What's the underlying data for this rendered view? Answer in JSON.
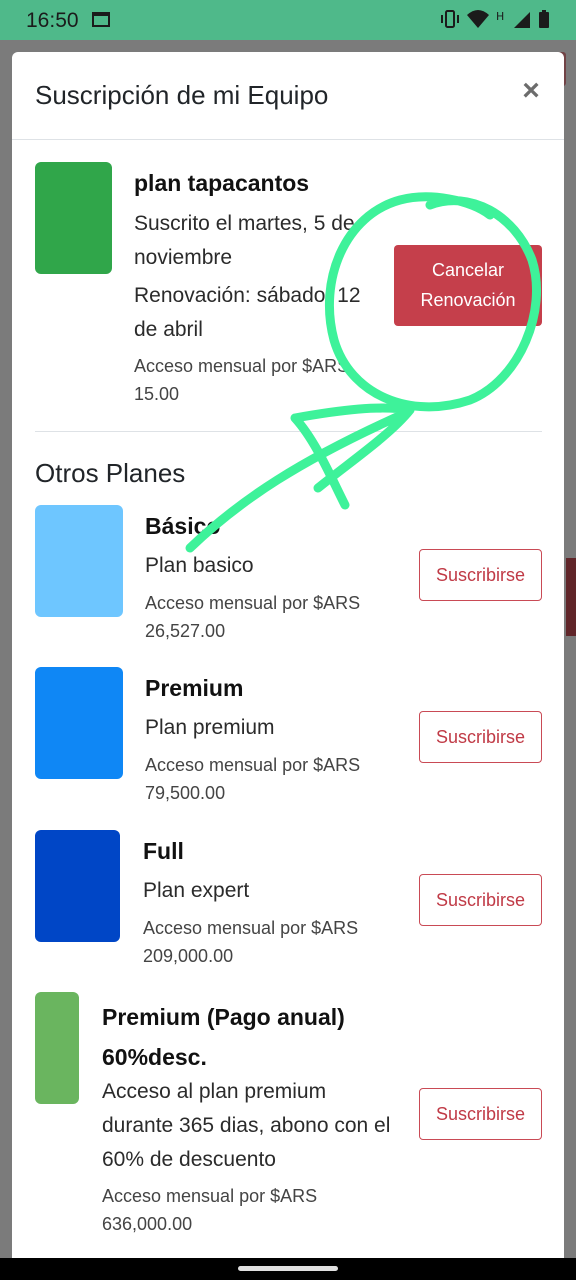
{
  "status_bar": {
    "time": "16:50",
    "icons": [
      "calendar-icon",
      "vibrate-icon",
      "wifi-icon",
      "h-network-icon",
      "signal-icon",
      "battery-icon"
    ]
  },
  "modal": {
    "title": "Suscripción de mi Equipo",
    "close_label": "×"
  },
  "current_plan": {
    "name": "plan tapacantos",
    "subscribed": "Suscrito el martes, 5 de noviembre",
    "renewal": "Renovación: sábado, 12 de abril",
    "price": "Acceso mensual por $ARS 15.00",
    "color": "#30a64a",
    "cancel_label": "Cancelar Renovación"
  },
  "other_plans": {
    "title": "Otros Planes",
    "subscribe_label": "Suscribirse",
    "items": [
      {
        "name": "Básico",
        "desc": "Plan basico",
        "price": "Acceso mensual por $ARS 26,527.00",
        "color": "#6ec6ff"
      },
      {
        "name": "Premium",
        "desc": "Plan premium",
        "price": "Acceso mensual por $ARS 79,500.00",
        "color": "#0f87f5"
      },
      {
        "name": "Full",
        "desc": "Plan expert",
        "price": "Acceso mensual por $ARS 209,000.00",
        "color": "#0046c6"
      },
      {
        "name": "Premium (Pago anual) 60%desc.",
        "desc": "Acceso al plan premium durante 365 dias, abono con el 60% de descuento",
        "price": "Acceso mensual por $ARS 636,000.00",
        "color": "#6ab55f"
      }
    ]
  },
  "annotation": {
    "color": "#3ef29a"
  }
}
